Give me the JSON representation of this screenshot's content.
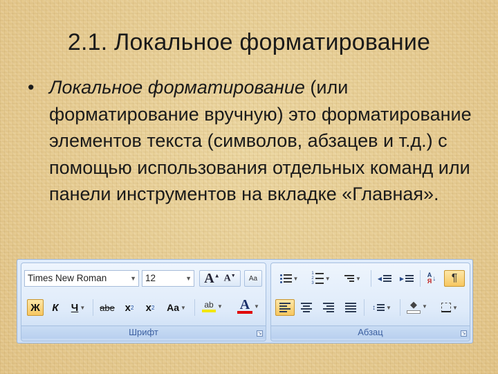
{
  "slide": {
    "title": "2.1. Локальное форматирование",
    "bullet": "•",
    "term": "Локальное форматирование",
    "definition": " (или форматирование вручную) это форматирование элементов текста (символов, абзацев и т.д.) с помощью использования отдельных команд или панели инструментов на вкладке «Главная»."
  },
  "ribbon": {
    "font_group": {
      "label": "Шрифт",
      "font_name": "Times New Roman",
      "font_size": "12",
      "grow_font": "A",
      "shrink_font": "A",
      "clear_format_letters": "Aa",
      "bold": "Ж",
      "italic": "К",
      "underline": "Ч",
      "strikethrough": "abe",
      "subscript_base": "x",
      "subscript_mark": "2",
      "superscript_base": "x",
      "superscript_mark": "2",
      "change_case": "Aa",
      "highlight_letters": "ab",
      "font_color_letter": "A",
      "highlight_color": "#f2e600",
      "font_color_bar": "#e00000"
    },
    "paragraph_group": {
      "label": "Абзац",
      "pilcrow": "¶",
      "sort_top": "А",
      "sort_bottom": "Я"
    }
  }
}
